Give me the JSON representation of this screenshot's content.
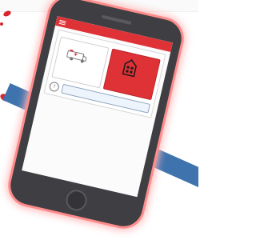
{
  "app": {
    "title": "",
    "card_title": "",
    "left_tile_label": "",
    "right_tile_label": "",
    "help_link_label": ""
  },
  "colors": {
    "brand_red": "#df3236",
    "band_blue": "#3f73ad",
    "phone_body": "#3f3f43",
    "screen_bg": "#fbfbfb",
    "phone_glow": "#ff8b8b"
  },
  "icons": {
    "menu": "menu-icon",
    "ambulance": "ambulance-icon",
    "building": "building-icon",
    "help": "help-icon"
  }
}
